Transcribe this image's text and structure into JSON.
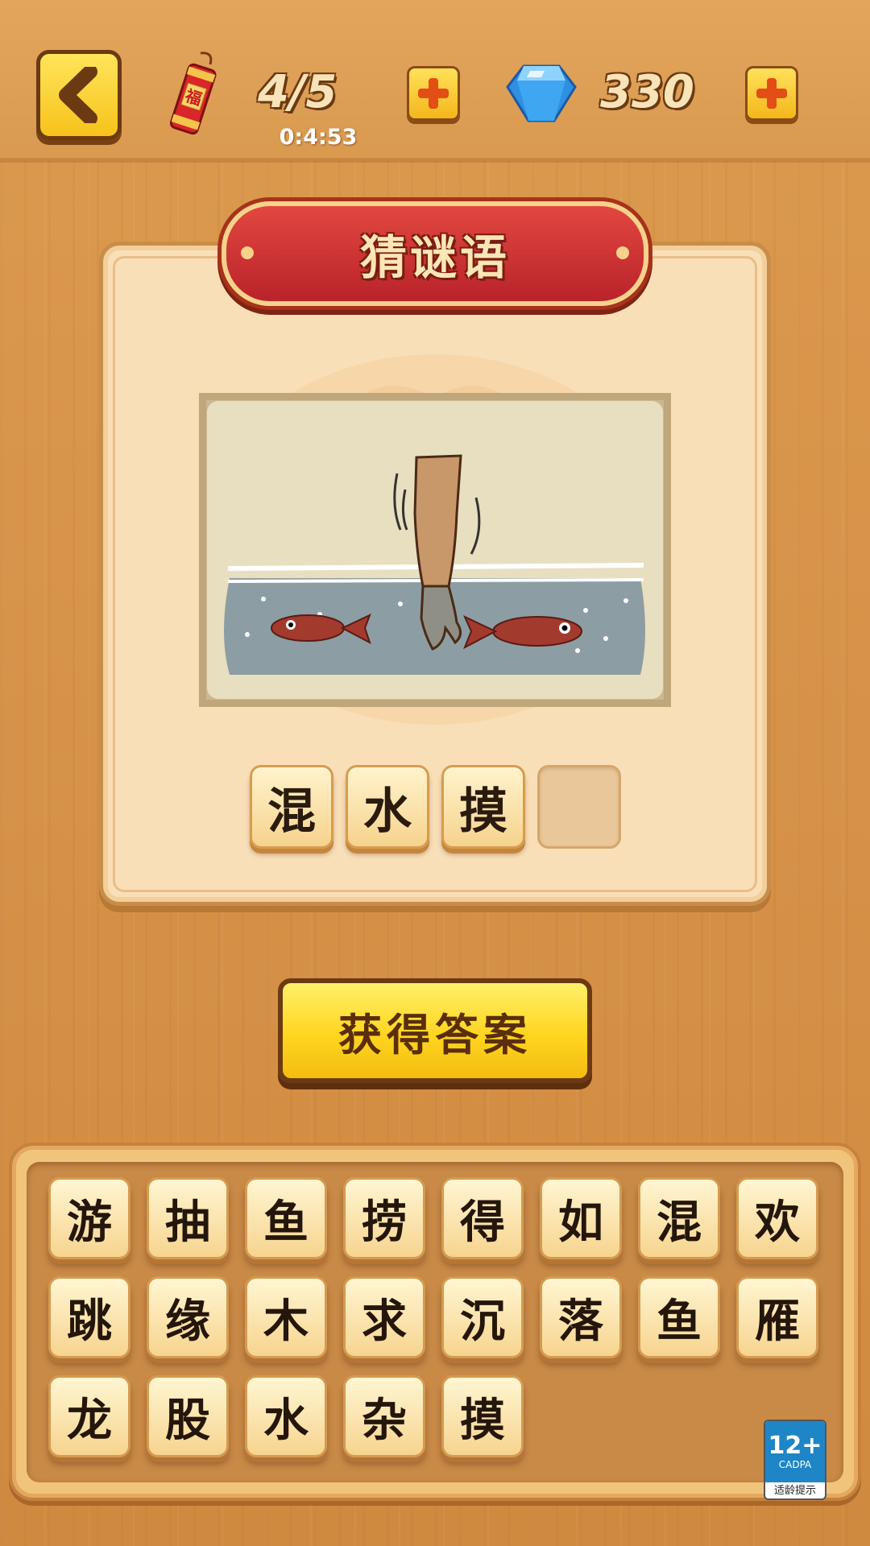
{
  "header": {
    "lives": "4/5",
    "timer": "0:4:53",
    "gems": "330",
    "firecracker_label": "福"
  },
  "puzzle": {
    "title": "猜谜语",
    "answer_slots": [
      "混",
      "水",
      "摸",
      ""
    ]
  },
  "hint_button": {
    "label": "获得答案"
  },
  "keyboard": {
    "rows": [
      [
        "游",
        "抽",
        "鱼",
        "捞",
        "得",
        "如",
        "混",
        "欢"
      ],
      [
        "跳",
        "缘",
        "木",
        "求",
        "沉",
        "落",
        "鱼",
        "雁"
      ],
      [
        "龙",
        "股",
        "水",
        "杂",
        "摸"
      ]
    ]
  },
  "age_badge": {
    "rating": "12+",
    "org": "CADPA",
    "caption": "适龄提示"
  },
  "colors": {
    "wood": "#d99a50",
    "panel": "#f9dfb8",
    "banner_red": "#c52e2e",
    "button_yellow": "#ffd51f",
    "tile": "#f7d48f"
  },
  "icons": [
    "back-arrow-icon",
    "firecracker-icon",
    "plus-icon",
    "gem-icon"
  ]
}
